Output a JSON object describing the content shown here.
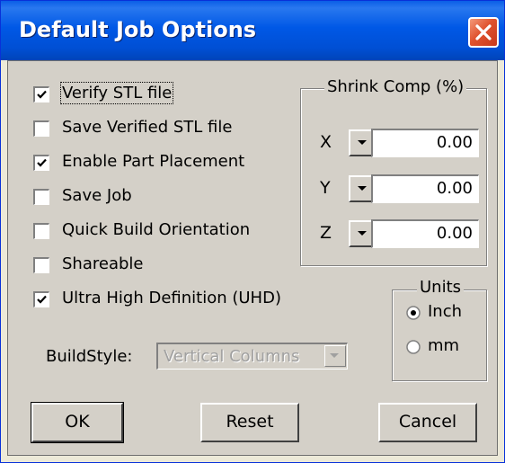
{
  "window": {
    "title": "Default Job Options",
    "close_icon": "close-icon"
  },
  "options": {
    "verify_stl": {
      "label": "Verify STL file",
      "checked": true
    },
    "save_verified_stl": {
      "label": "Save Verified STL file",
      "checked": false
    },
    "enable_part_placement": {
      "label": "Enable Part Placement",
      "checked": true
    },
    "save_job": {
      "label": "Save Job",
      "checked": false
    },
    "quick_build_orientation": {
      "label": "Quick Build Orientation",
      "checked": false
    },
    "shareable": {
      "label": "Shareable",
      "checked": false
    },
    "uhd": {
      "label": "Ultra High Definition (UHD)",
      "checked": true
    }
  },
  "shrink_comp": {
    "title": "Shrink Comp (%)",
    "x": {
      "label": "X",
      "value": "0.00"
    },
    "y": {
      "label": "Y",
      "value": "0.00"
    },
    "z": {
      "label": "Z",
      "value": "0.00"
    }
  },
  "units": {
    "title": "Units",
    "inch": {
      "label": "Inch",
      "selected": true
    },
    "mm": {
      "label": "mm",
      "selected": false
    }
  },
  "build_style": {
    "label": "BuildStyle:",
    "value": "Vertical Columns",
    "enabled": false
  },
  "buttons": {
    "ok": "OK",
    "reset": "Reset",
    "cancel": "Cancel"
  },
  "colors": {
    "titlebar": "#0058e6",
    "dialog_face": "#d4d0c8",
    "close_button": "#e0532f"
  }
}
